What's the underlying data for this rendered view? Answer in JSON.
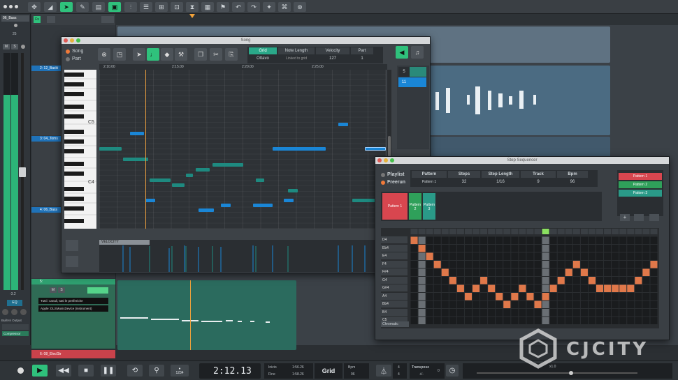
{
  "song_window": {
    "title": "Song",
    "mode_song": "Song",
    "mode_part": "Part",
    "props": {
      "grid_label": "Grid",
      "grid_value": "Ottavo",
      "note_length_label": "Note Length",
      "note_length_value": "Linked to grid",
      "velocity_label": "Velocity",
      "velocity_value": "127",
      "part_label": "Part",
      "part_value": "1"
    },
    "ruler_marks": [
      "2:10.00",
      "2:15.00",
      "2:20.00",
      "2:25.00"
    ],
    "key_c5": "C5",
    "key_c4": "C4",
    "velocity_label": "VELOCITY",
    "side_numbers": [
      "5",
      "11"
    ]
  },
  "tracks": {
    "t1": "06_Bass",
    "t2": "2: 12_Backi",
    "t3": "3: 04_Toms",
    "t4": "4: 06_Bass",
    "t5": "5:",
    "t6": "6: 08_ElecGtr",
    "mute": "M",
    "solo": "S"
  },
  "left_strip": {
    "pan_value": "25",
    "level": "-3.2",
    "eq": "EQ",
    "output": "Built-In Output",
    "compressor": "Compressor"
  },
  "midi_track": {
    "input": "Tutti i canali, tutti le periferiche",
    "instrument": "Apple: DLSMusicDevice (instrument)"
  },
  "step_sequencer": {
    "title": "Step Sequencer",
    "mode_playlist": "Playlist",
    "mode_freerun": "Freerun",
    "headers": {
      "pattern": "Pattern",
      "steps": "Steps",
      "step_length": "Step Length",
      "track": "Track",
      "bpm": "Bpm"
    },
    "values": {
      "pattern": "Pattern 1",
      "steps": "32",
      "step_length": "1/16",
      "track": "9",
      "bpm": "96"
    },
    "patterns_list": [
      "Pattern 1",
      "Pattern 2",
      "Pattern 3"
    ],
    "slots": {
      "p1": "Pattern 1",
      "p2a": "Pattern",
      "p2b": "2",
      "p3a": "Pattern",
      "p3b": "3"
    },
    "lanes": [
      "D4",
      "Eb4",
      "E4",
      "F4",
      "F#4",
      "G4",
      "G#4",
      "A4",
      "Bb4",
      "B4",
      "C5"
    ],
    "scale": "Chromatic",
    "active_rows": [
      0,
      1,
      2,
      3,
      4,
      5,
      6,
      7,
      6,
      5,
      6,
      7,
      8,
      7,
      6,
      7,
      8,
      7,
      6,
      5,
      4,
      3,
      4,
      5,
      6,
      6,
      6,
      6,
      6,
      5,
      4,
      3
    ]
  },
  "transport": {
    "time": "2:12.13",
    "inizio_label": "Inizio",
    "inizio_value": "1:56.26",
    "fine_label": "Fine",
    "fine_value": "1:58.26",
    "grid": "Grid",
    "bpm_label": "Bpm",
    "bpm_value": "96",
    "sig_top": "4",
    "sig_bottom": "4",
    "transpose_label": "Transpose",
    "transpose_value": "+/-",
    "transpose_num": "0",
    "zoom": "x1.0",
    "counter": "1234"
  },
  "watermark": "CJCITY",
  "colors": {
    "accent": "#2fc17c",
    "note_blue": "#1a86d6",
    "note_teal": "#1e8a80",
    "step_on": "#e0784a",
    "pattern_red": "#d8464f"
  }
}
